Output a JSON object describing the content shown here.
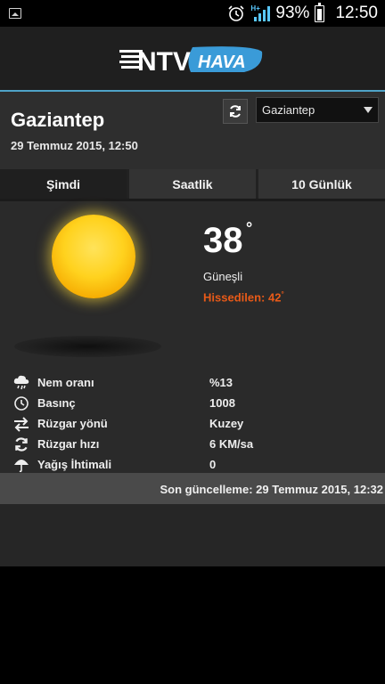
{
  "status_bar": {
    "battery_percent": "93%",
    "time": "12:50",
    "network": "H+"
  },
  "header": {
    "logo_text_1": "NTV",
    "logo_text_2": "HAVA"
  },
  "location": {
    "city": "Gaziantep",
    "date": "29 Temmuz 2015, 12:50",
    "selected_city": "Gaziantep"
  },
  "tabs": [
    {
      "label": "Şimdi",
      "active": true
    },
    {
      "label": "Saatlik",
      "active": false
    },
    {
      "label": "10 Günlük",
      "active": false
    }
  ],
  "current": {
    "temperature": "38",
    "degree_symbol": "°",
    "condition": "Güneşli",
    "feels_like_label": "Hissedilen: 42",
    "feels_like_symbol": "°",
    "icon": "sun-icon"
  },
  "details": [
    {
      "icon": "cloud-rain-icon",
      "label": "Nem oranı",
      "value": "%13"
    },
    {
      "icon": "clock-icon",
      "label": "Basınç",
      "value": "1008"
    },
    {
      "icon": "arrows-exchange-icon",
      "label": "Rüzgar yönü",
      "value": "Kuzey"
    },
    {
      "icon": "refresh-icon",
      "label": "Rüzgar hızı",
      "value": "6 KM/sa"
    },
    {
      "icon": "umbrella-icon",
      "label": "Yağış İhtimali",
      "value": "0"
    }
  ],
  "last_update": "Son güncelleme: 29 Temmuz 2015, 12:32",
  "colors": {
    "accent_line": "#4fa3c8",
    "feels_like": "#e85a18",
    "logo_blue": "#3a9bd8"
  }
}
